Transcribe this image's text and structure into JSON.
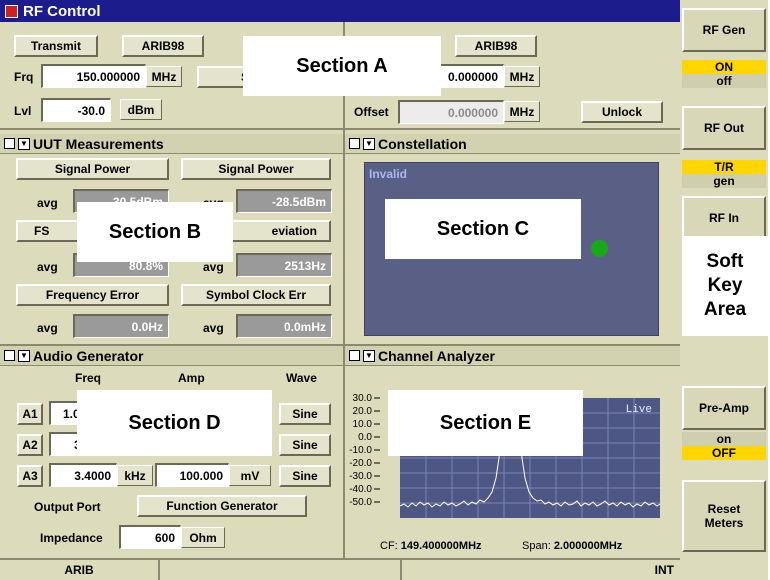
{
  "window": {
    "title": "RF Control"
  },
  "rf_control": {
    "transmit_label": "Transmit",
    "standard_left": "ARIB98",
    "standard_right": "ARIB98",
    "frq_label": "Frq",
    "frq_value": "150.000000",
    "frq_unit": "MHz",
    "setup_partial": "S",
    "rx_freq_partial": "0.000000",
    "rx_freq_unit": "MHz",
    "lvl_label": "Lvl",
    "lvl_value": "-30.0",
    "lvl_unit": "dBm",
    "offset_label": "Offset",
    "offset_value": "0.000000",
    "offset_unit": "MHz",
    "unlock_label": "Unlock"
  },
  "uut": {
    "title": "UUT Measurements",
    "sig_power_1": "Signal Power",
    "sig_power_2": "Signal Power",
    "avg": "avg",
    "val_1": "-30.5dBm",
    "val_2": "-28.5dBm",
    "fs_partial": "FS",
    "deviation_partial": "eviation",
    "val_3": "80.8%",
    "val_4": "2513Hz",
    "avg_partial": "avg",
    "freq_error": "Frequency Error",
    "symbol_clock": "Symbol Clock Err",
    "val_5": "0.0Hz",
    "val_6": "0.0mHz"
  },
  "constellation": {
    "title": "Constellation",
    "status": "Invalid"
  },
  "audio": {
    "title": "Audio Generator",
    "col_freq": "Freq",
    "col_amp": "Amp",
    "col_wave": "Wave",
    "rows": [
      {
        "name": "A1",
        "freq": "1.0",
        "wave": "Sine"
      },
      {
        "name": "A2",
        "freq": "3",
        "wave": "Sine"
      },
      {
        "name": "A3",
        "freq": "3.4000",
        "freq_unit": "kHz",
        "amp": "100.000",
        "amp_unit": "mV",
        "wave": "Sine"
      }
    ],
    "output_port_label": "Output Port",
    "output_port_value": "Function Generator",
    "impedance_label": "Impedance",
    "impedance_value": "600",
    "impedance_unit": "Ohm"
  },
  "channel": {
    "title": "Channel Analyzer",
    "live": "Live",
    "y_ticks": [
      "30.0",
      "20.0",
      "10.0",
      "0.0",
      "-10.0",
      "-20.0",
      "-30.0",
      "-40.0",
      "-50.0"
    ],
    "cf_label": "CF:",
    "cf_value": "149.400000MHz",
    "span_label": "Span:",
    "span_value": "2.000000MHz"
  },
  "softkeys": {
    "rf_gen": "RF Gen",
    "rf_gen_on": "ON",
    "rf_gen_off": "off",
    "rf_out": "RF Out",
    "rf_out_tr": "T/R",
    "rf_out_gen": "gen",
    "rf_in": "RF In",
    "soft_key_area": "Soft Key Area",
    "pre_amp": "Pre-Amp",
    "pre_amp_on": "on",
    "pre_amp_off": "OFF",
    "reset_meters": "Reset Meters"
  },
  "status_bar": {
    "left": "ARIB",
    "right": "INT"
  },
  "sections": {
    "a": "Section A",
    "b": "Section B",
    "c": "Section  C",
    "d": "Section  D",
    "e": "Section  E"
  },
  "colors": {
    "title_bar": "#1c1c8c",
    "highlight": "#ffd600",
    "plot_bg": "#5a5f86",
    "marker": "#18a818"
  }
}
